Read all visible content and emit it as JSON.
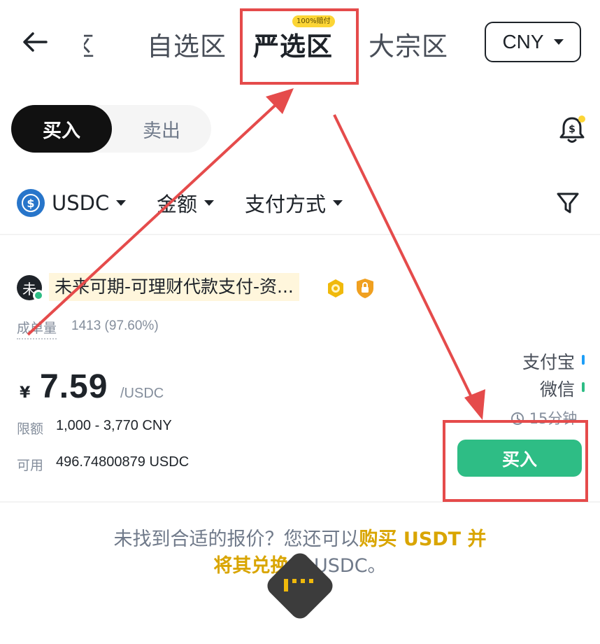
{
  "header": {
    "back_icon": "arrow-left-icon",
    "tabs": [
      {
        "label": "区",
        "active": false,
        "partial": true
      },
      {
        "label": "自选区",
        "active": false
      },
      {
        "label": "严选区",
        "active": true,
        "badge": "100%赔付"
      },
      {
        "label": "大宗区",
        "active": false
      }
    ],
    "currency": "CNY"
  },
  "toggle": {
    "buy": "买入",
    "sell": "卖出",
    "selected": "buy"
  },
  "filters": {
    "coin": "USDC",
    "amount": "金额",
    "payment": "支付方式"
  },
  "offer": {
    "avatar_char": "未",
    "merchant": "未来可期-可理财代款支付-资...",
    "orders_label": "成单量",
    "orders_value": "1413 (97.60%)",
    "currency_symbol": "¥",
    "price": "7.59",
    "price_unit": "/USDC",
    "limit_label": "限额",
    "limit_value": "1,000 - 3,770 CNY",
    "available_label": "可用",
    "available_value": "496.74800879 USDC",
    "payment_methods": [
      {
        "name": "支付宝",
        "color": "#1e9ef7"
      },
      {
        "name": "微信",
        "color": "#2ebd85"
      }
    ],
    "time_limit": "15分钟",
    "buy_button": "买入"
  },
  "footer": {
    "line1_plain": "未找到合适的报价？您还可以",
    "line1_link": "购买 USDT 并",
    "line2_link": "将其兑换",
    "line2_plain": "为 USDC。"
  },
  "colors": {
    "accent_green": "#2ebd85",
    "brand_yellow": "#fcd535",
    "annotation_red": "#e54b4b"
  }
}
